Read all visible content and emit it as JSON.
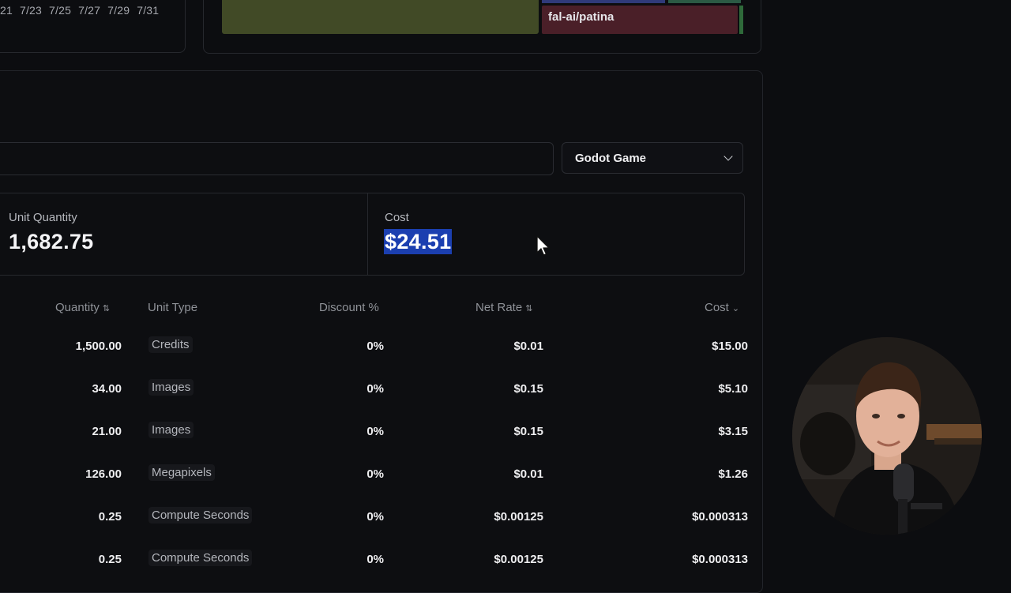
{
  "chart": {
    "dates": [
      "21",
      "7/23",
      "7/25",
      "7/27",
      "7/29",
      "7/31"
    ],
    "treemap_label": "fal-ai/patina"
  },
  "filter": {
    "search_value": "",
    "project_select": "Godot Game"
  },
  "stats": {
    "unit_quantity_label": "Unit Quantity",
    "unit_quantity_value": "1,682.75",
    "cost_label": "Cost",
    "cost_value": "$24.51"
  },
  "table": {
    "headers": {
      "quantity": "Quantity",
      "unit_type": "Unit Type",
      "discount": "Discount %",
      "net_rate": "Net Rate",
      "cost": "Cost"
    },
    "rows": [
      {
        "quantity": "1,500.00",
        "unit_type": "Credits",
        "discount": "0%",
        "net_rate": "$0.01",
        "cost": "$15.00"
      },
      {
        "quantity": "34.00",
        "unit_type": "Images",
        "discount": "0%",
        "net_rate": "$0.15",
        "cost": "$5.10"
      },
      {
        "quantity": "21.00",
        "unit_type": "Images",
        "discount": "0%",
        "net_rate": "$0.15",
        "cost": "$3.15"
      },
      {
        "quantity": "126.00",
        "unit_type": "Megapixels",
        "discount": "0%",
        "net_rate": "$0.01",
        "cost": "$1.26"
      },
      {
        "quantity": "0.25",
        "unit_type": "Compute Seconds",
        "discount": "0%",
        "net_rate": "$0.00125",
        "cost": "$0.000313"
      },
      {
        "quantity": "0.25",
        "unit_type": "Compute Seconds",
        "discount": "0%",
        "net_rate": "$0.00125",
        "cost": "$0.000313"
      }
    ]
  },
  "colors": {
    "background": "#0c0d10",
    "selection": "#1b3fb0",
    "treemap_olive": "#414a26",
    "treemap_red": "#4a1f28"
  }
}
